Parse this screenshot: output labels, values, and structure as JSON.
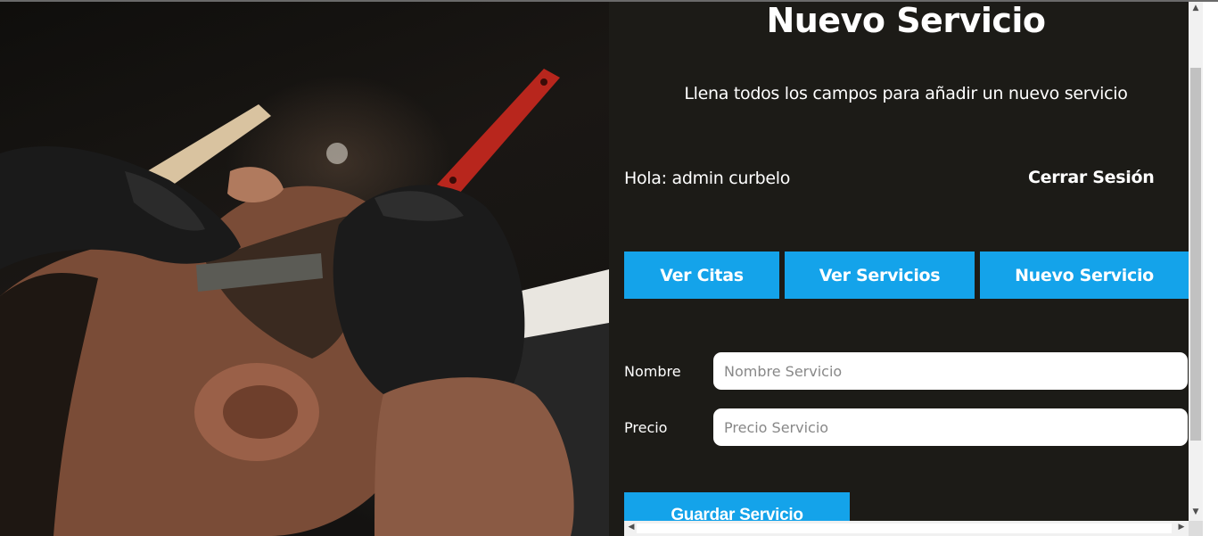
{
  "page": {
    "title": "Nuevo Servicio",
    "subtitle": "Llena todos los campos para añadir un nuevo servicio"
  },
  "session": {
    "greeting": "Hola: admin curbelo",
    "logout_label": "Cerrar Sesión"
  },
  "nav": {
    "items": [
      {
        "label": "Ver Citas"
      },
      {
        "label": "Ver Servicios"
      },
      {
        "label": "Nuevo Servicio"
      }
    ]
  },
  "form": {
    "nombre": {
      "label": "Nombre",
      "placeholder": "Nombre Servicio",
      "value": ""
    },
    "precio": {
      "label": "Precio",
      "placeholder": "Precio Servicio",
      "value": ""
    },
    "submit_label": "Guardar Servicio"
  },
  "colors": {
    "background": "#1c1b17",
    "accent": "#14a3ea",
    "text": "#ffffff"
  },
  "icons": {
    "scroll_up": "triangle-up-icon",
    "scroll_down": "triangle-down-icon",
    "scroll_left": "triangle-left-icon",
    "scroll_right": "triangle-right-icon"
  }
}
